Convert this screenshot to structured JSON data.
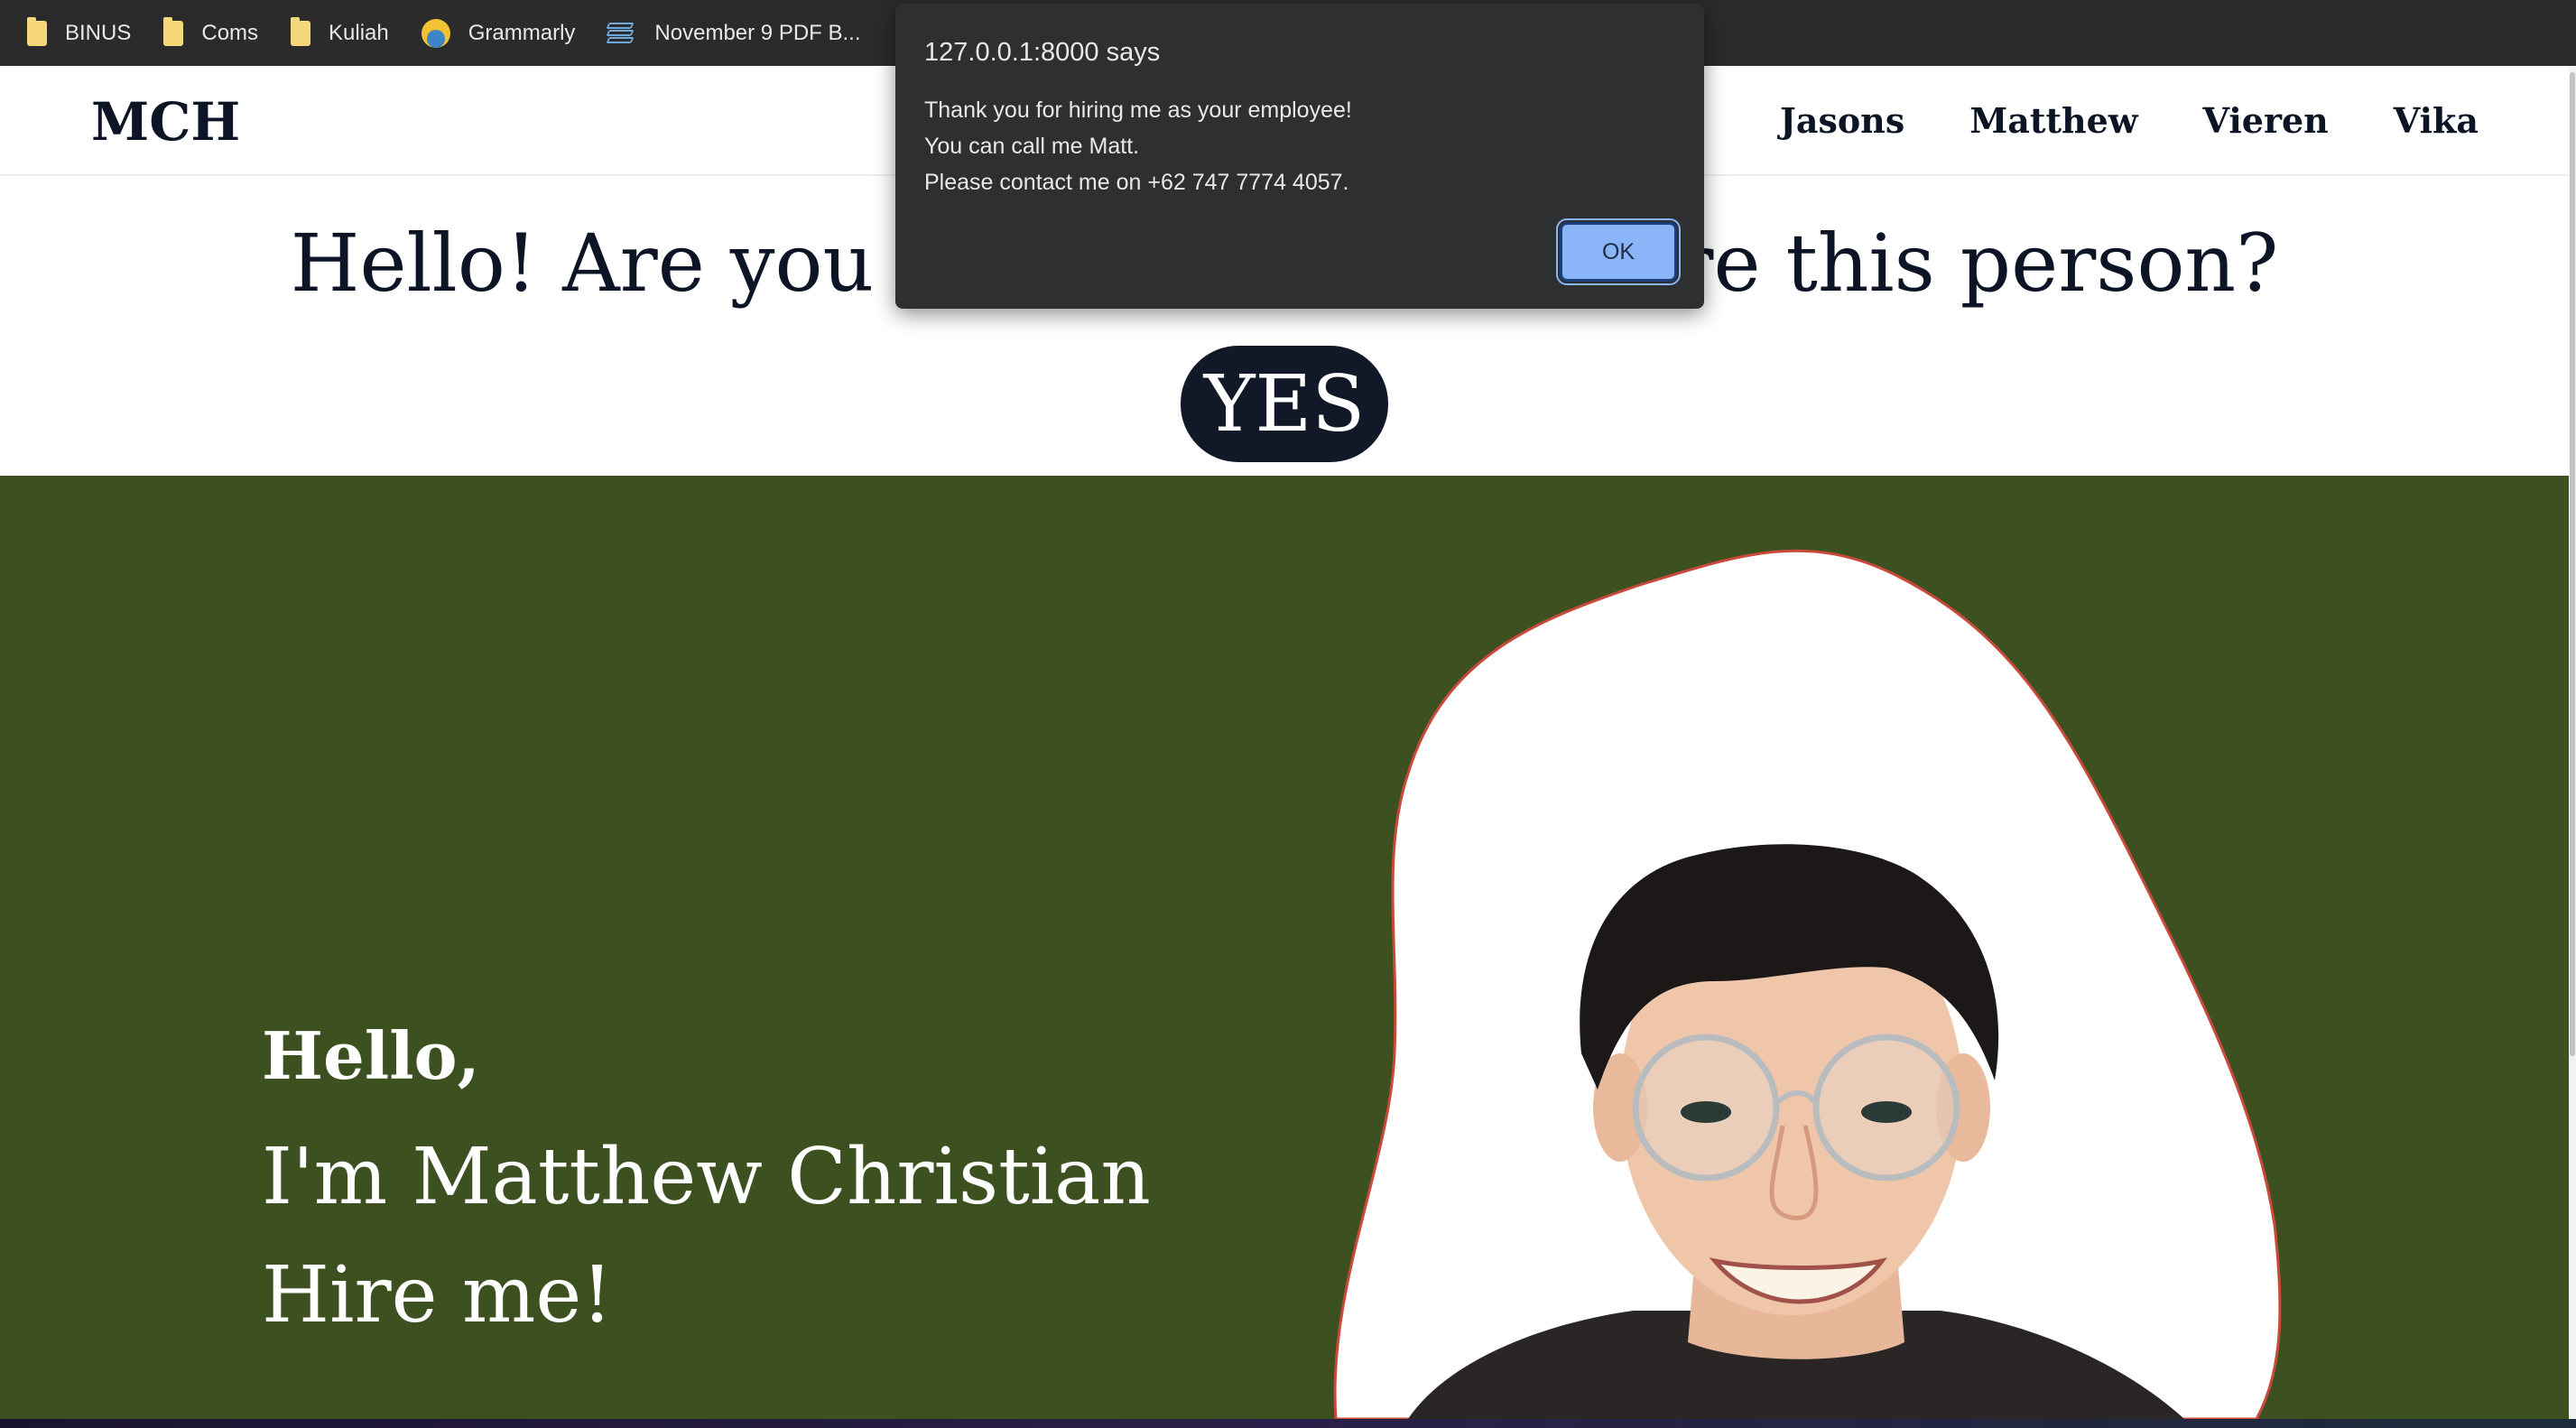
{
  "bookmarks": [
    {
      "label": "BINUS",
      "icon": "folder-icon"
    },
    {
      "label": "Coms",
      "icon": "folder-icon"
    },
    {
      "label": "Kuliah",
      "icon": "folder-icon"
    },
    {
      "label": "Grammarly",
      "icon": "grammarly-icon"
    },
    {
      "label": "November 9 PDF B...",
      "icon": "pdf-stack-icon"
    }
  ],
  "navbar": {
    "brand": "MCH",
    "links": [
      "Jasons",
      "Matthew",
      "Vieren",
      "Vika"
    ]
  },
  "question": {
    "text": "Hello! Are you sure you want to hire this person?",
    "yes_label": "YES"
  },
  "hero": {
    "greeting": "Hello,",
    "name_line": "I'm Matthew Christian",
    "cta_line": "Hire me!",
    "background_color": "#3d5120"
  },
  "dialog": {
    "title": "127.0.0.1:8000 says",
    "lines": [
      "Thank you for hiring me as your employee!",
      "You can call me Matt.",
      "Please contact me on +62 747 7774 4057."
    ],
    "ok_label": "OK"
  }
}
